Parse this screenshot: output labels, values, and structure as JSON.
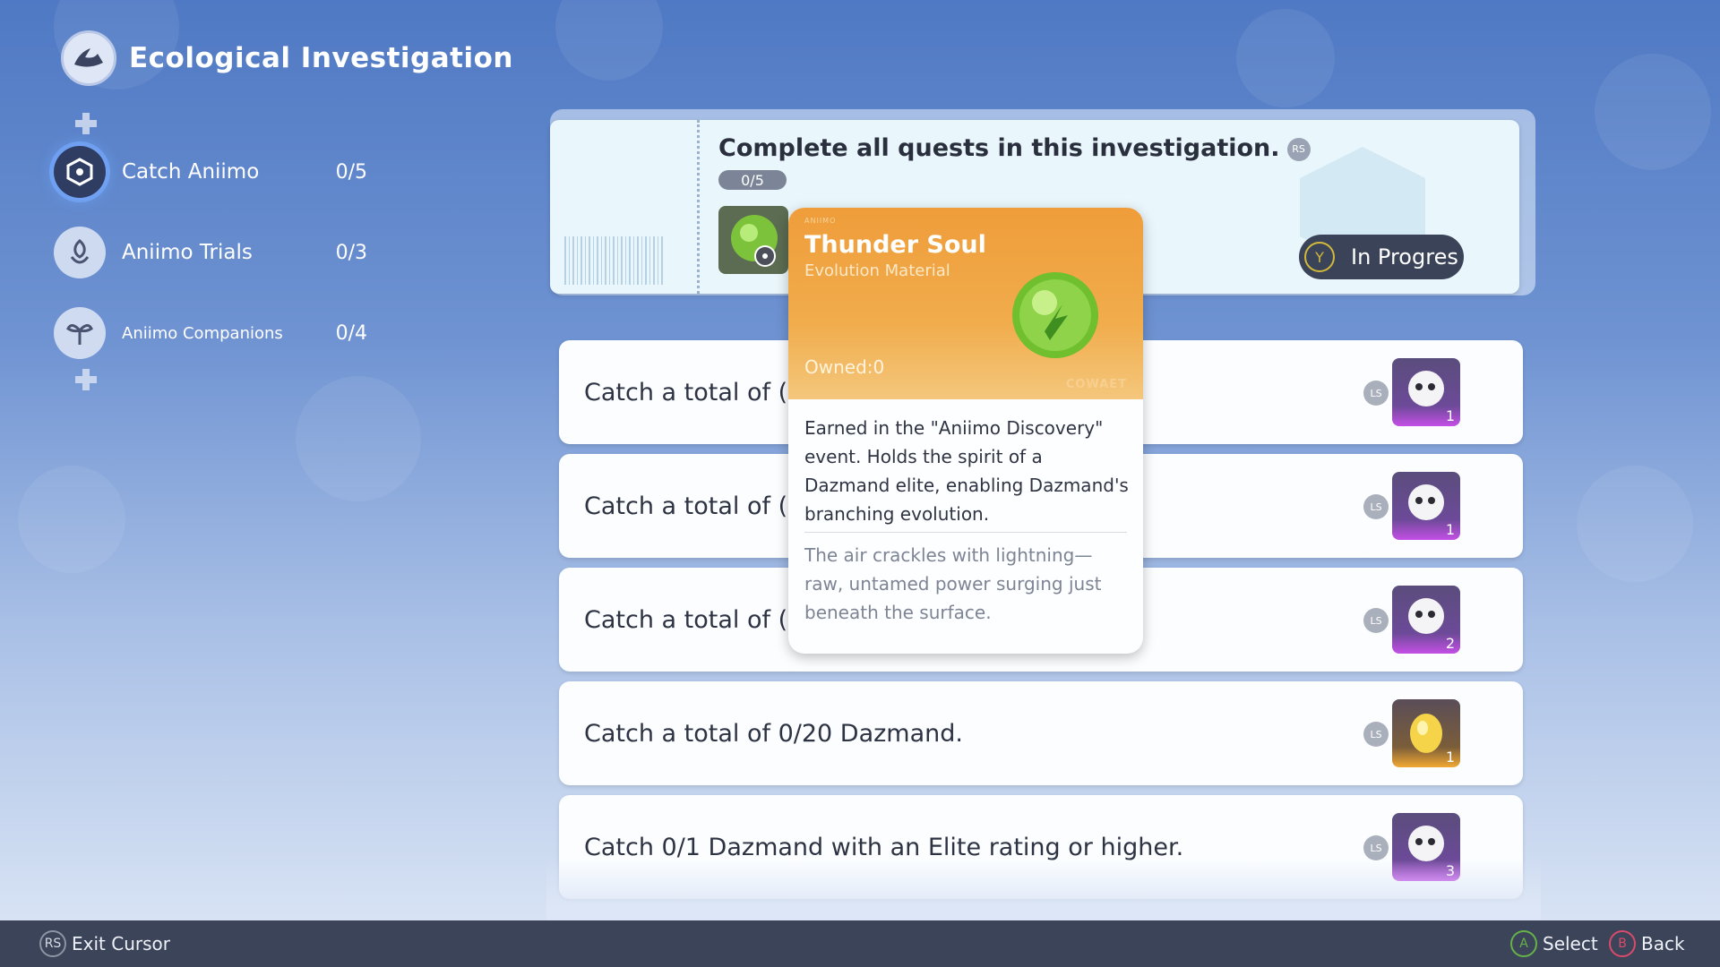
{
  "header": {
    "title": "Ecological Investigation",
    "logo_icon": "boat-logo-icon"
  },
  "sidebar": {
    "items": [
      {
        "label": "Catch Aniimo",
        "count": "0/5",
        "icon": "cube-icon",
        "active": true
      },
      {
        "label": "Aniimo Trials",
        "count": "0/3",
        "icon": "creature-icon",
        "active": false
      },
      {
        "label": "Aniimo Companions",
        "count": "0/4",
        "icon": "sprout-icon",
        "active": false
      }
    ]
  },
  "main_quest": {
    "title": "Complete all quests in this investigation.",
    "rs_badge": "RS",
    "progress": "0/5",
    "status": "In Progres",
    "status_button": "Y"
  },
  "quests": [
    {
      "text": "Catch a total of (",
      "badge": "LS",
      "reward_count": "1",
      "reward_type": "creature"
    },
    {
      "text": "Catch a total of (",
      "badge": "LS",
      "reward_count": "1",
      "reward_type": "creature"
    },
    {
      "text": "Catch a total of (",
      "badge": "LS",
      "reward_count": "2",
      "reward_type": "creature"
    },
    {
      "text": "Catch a total of 0/20 Dazmand.",
      "badge": "LS",
      "reward_count": "1",
      "reward_type": "egg"
    },
    {
      "text": "Catch 0/1 Dazmand with an Elite rating or higher.",
      "badge": "LS",
      "reward_count": "3",
      "reward_type": "creature"
    }
  ],
  "tooltip": {
    "tag": "ANIIMO",
    "name": "Thunder Soul",
    "subtitle": "Evolution Material",
    "owned": "Owned:0",
    "brand": "COWAET",
    "description": "Earned in the \"Aniimo Discovery\" event. Holds the spirit of a Dazmand elite, enabling Dazmand's branching evolution.",
    "flavor": "The air crackles with lightning—raw, untamed power surging just beneath the surface."
  },
  "footer": {
    "exit": {
      "button": "RS",
      "label": "Exit Cursor"
    },
    "select": {
      "button": "A",
      "label": "Select"
    },
    "back": {
      "button": "B",
      "label": "Back"
    }
  },
  "colors": {
    "accent_blue": "#4f79c4",
    "footer_bg": "#3c4459",
    "tooltip_orange": "#ef9d3a",
    "reward_purple": "#6c4a98"
  }
}
